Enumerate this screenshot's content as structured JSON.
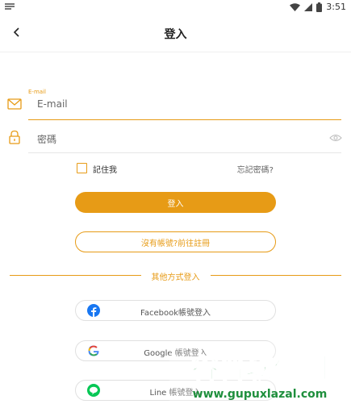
{
  "status": {
    "time": "3:51"
  },
  "appbar": {
    "title": "登入"
  },
  "form": {
    "email_label": "E-mail",
    "email_placeholder": "E-mail",
    "password_placeholder": "密碼",
    "remember_label": "記住我",
    "forgot_label": "忘記密碼?"
  },
  "buttons": {
    "login": "登入",
    "register": "沒有帳號?前往註冊"
  },
  "divider": {
    "text": "其他方式登入"
  },
  "social": {
    "facebook": "Facebook帳號登入",
    "google": "Google 帳號登入",
    "line": "Line 帳號登入"
  },
  "watermark": {
    "title": "谷普软件园",
    "url": "www.gupuxlazal.com"
  },
  "colors": {
    "accent": "#e79b16",
    "facebook": "#1877f2",
    "line": "#06c755"
  }
}
